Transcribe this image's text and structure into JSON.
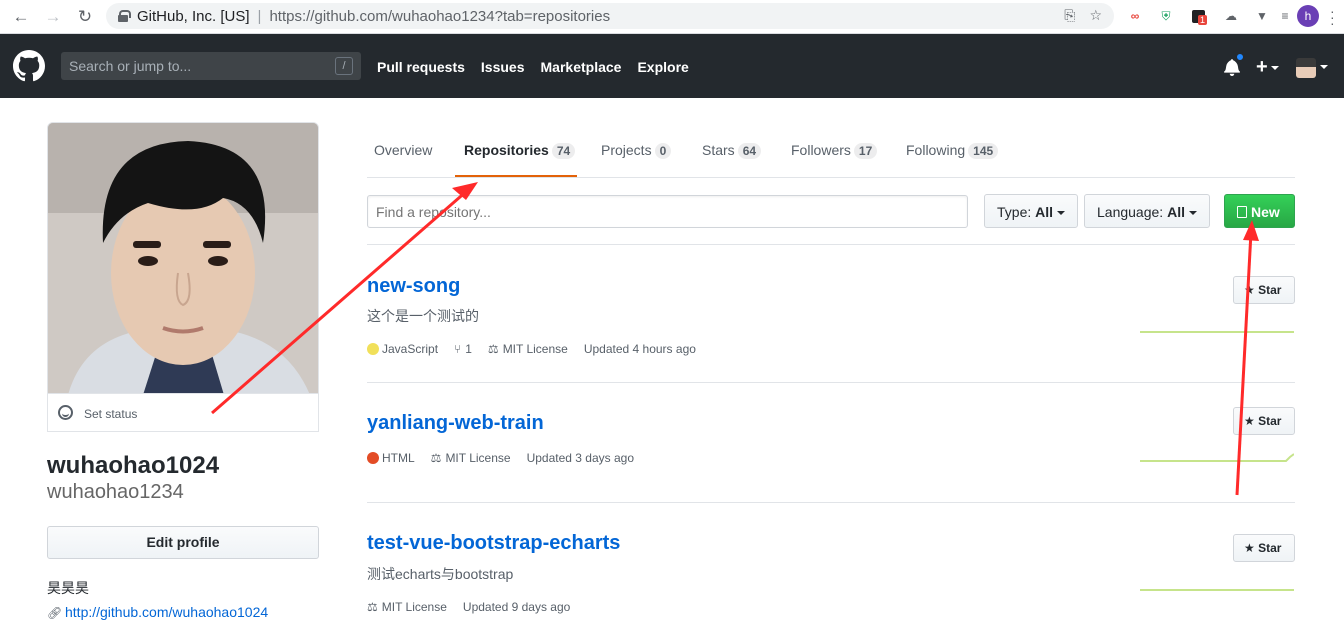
{
  "browser": {
    "org": "GitHub, Inc. [US]",
    "separator": "|",
    "url": "https://github.com/wuhaohao1234?tab=repositories",
    "profile_initial": "h",
    "ext_badge": "1"
  },
  "header": {
    "search_placeholder": "Search or jump to...",
    "slash_key": "/",
    "nav": [
      "Pull requests",
      "Issues",
      "Marketplace",
      "Explore"
    ],
    "plus": "+"
  },
  "profile": {
    "set_status": "Set status",
    "fullname": "wuhaohao1024",
    "username": "wuhaohao1234",
    "edit_profile": "Edit profile",
    "bio": "昊昊昊",
    "link": "http://github.com/wuhaohao1024"
  },
  "tabs": [
    {
      "label": "Overview",
      "count": null
    },
    {
      "label": "Repositories",
      "count": "74"
    },
    {
      "label": "Projects",
      "count": "0"
    },
    {
      "label": "Stars",
      "count": "64"
    },
    {
      "label": "Followers",
      "count": "17"
    },
    {
      "label": "Following",
      "count": "145"
    }
  ],
  "filter": {
    "find_placeholder": "Find a repository...",
    "type_label": "Type:",
    "type_value": "All",
    "language_label": "Language:",
    "language_value": "All",
    "new_label": "New"
  },
  "star_label": "Star",
  "repos": [
    {
      "name": "new-song",
      "description": "这个是一个测试的",
      "language": "JavaScript",
      "language_color": "#f1e05a",
      "forks": "1",
      "license": "MIT License",
      "updated": "Updated 4 hours ago"
    },
    {
      "name": "yanliang-web-train",
      "description": "",
      "language": "HTML",
      "language_color": "#e34c26",
      "forks": "",
      "license": "MIT License",
      "updated": "Updated 3 days ago"
    },
    {
      "name": "test-vue-bootstrap-echarts",
      "description": "测试echarts与bootstrap",
      "language": "",
      "language_color": "",
      "forks": "",
      "license": "MIT License",
      "updated": "Updated 9 days ago"
    }
  ],
  "colors": {
    "header_bg": "#24292e",
    "link_blue": "#0366d6",
    "tab_accent": "#e36209",
    "new_green": "#28a745",
    "annotation_red": "#ff2a2a"
  }
}
